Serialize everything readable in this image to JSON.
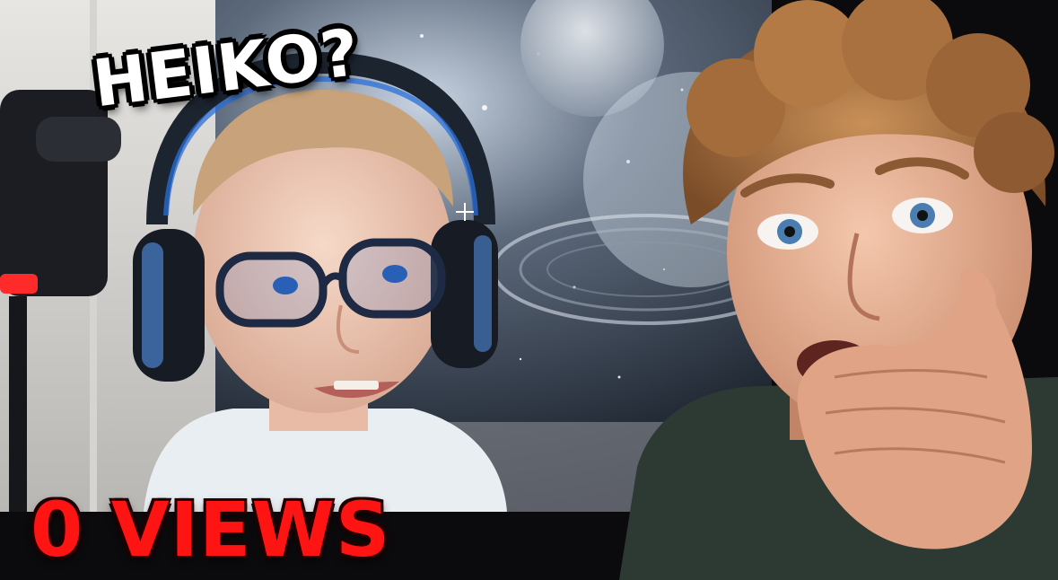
{
  "thumbnail": {
    "captions": {
      "top": "HEIKO?",
      "bottom": "0 VIEWS"
    },
    "colors": {
      "caption_top": "#ffffff",
      "caption_bottom": "#ff1414",
      "space_backdrop": "#1a2230",
      "shirt_right": "#2d3a34",
      "headset_accent": "#2a6fd8",
      "mic_led": "#ff2a2a"
    }
  }
}
